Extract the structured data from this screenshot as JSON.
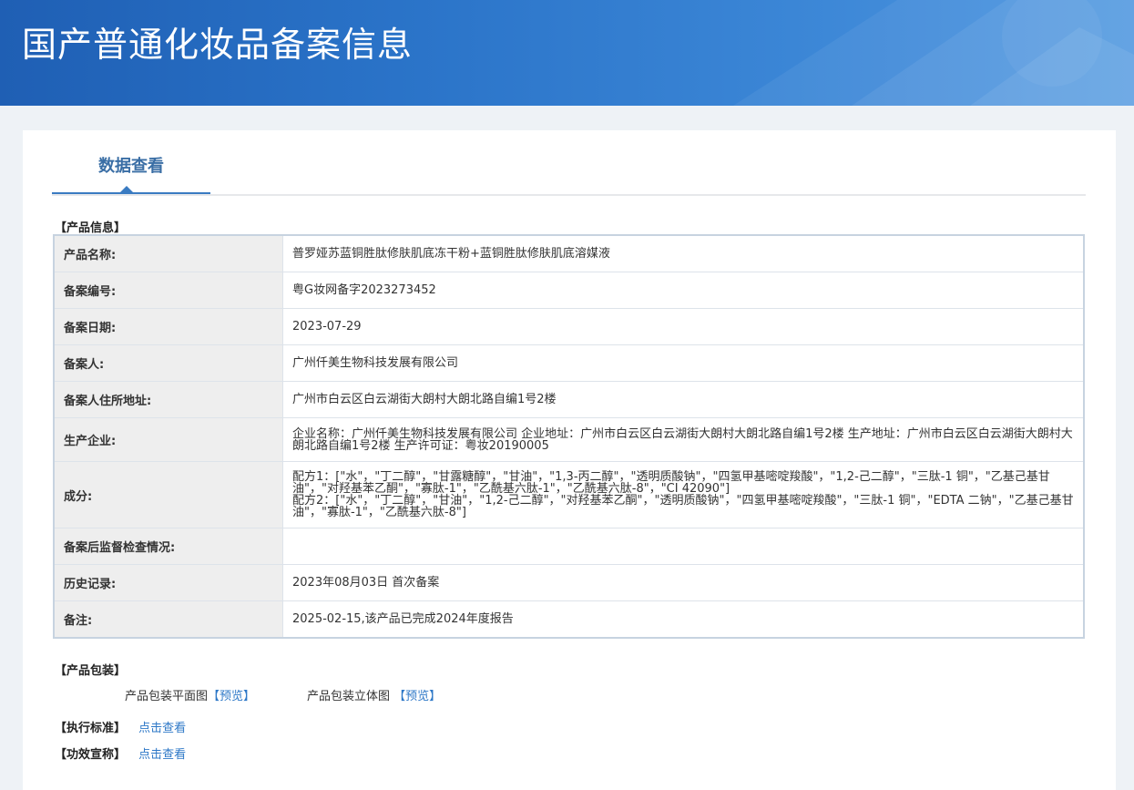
{
  "header": {
    "title": "国产普通化妆品备案信息"
  },
  "tabs": [
    {
      "label": "数据查看"
    }
  ],
  "product_info": {
    "section_title": "【产品信息】",
    "rows": [
      {
        "key": "产品名称:",
        "value": "普罗娅苏蓝铜胜肽修肤肌底冻干粉+蓝铜胜肽修肤肌底溶媒液"
      },
      {
        "key": "备案编号:",
        "value": "粤G妆网备字2023273452"
      },
      {
        "key": "备案日期:",
        "value": "2023-07-29"
      },
      {
        "key": "备案人:",
        "value": "广州仟美生物科技发展有限公司"
      },
      {
        "key": "备案人住所地址:",
        "value": "广州市白云区白云湖街大朗村大朗北路自编1号2楼"
      },
      {
        "key": "生产企业:",
        "value": "企业名称：广州仟美生物科技发展有限公司 企业地址：广州市白云区白云湖街大朗村大朗北路自编1号2楼 生产地址：广州市白云区白云湖街大朗村大朗北路自编1号2楼 生产许可证：粤妆20190005"
      },
      {
        "key": "成分:",
        "value_line1": "配方1：[\"水\"，\"丁二醇\"，\"甘露糖醇\"，\"甘油\"，\"1,3-丙二醇\"，\"透明质酸钠\"，\"四氢甲基嘧啶羧酸\"，\"1,2-己二醇\"，\"三肽-1 铜\"，\"乙基己基甘油\"，\"对羟基苯乙酮\"，\"寡肽-1\"，\"乙酰基六肽-1\"，\"乙酰基六肽-8\"，\"CI 42090\"]",
        "value_line2": "配方2：[\"水\"，\"丁二醇\"，\"甘油\"，\"1,2-己二醇\"，\"对羟基苯乙酮\"，\"透明质酸钠\"，\"四氢甲基嘧啶羧酸\"，\"三肽-1 铜\"，\"EDTA 二钠\"，\"乙基己基甘油\"，\"寡肽-1\"，\"乙酰基六肽-8\"]"
      },
      {
        "key": "备案后监督检查情况:",
        "value": ""
      },
      {
        "key": "历史记录:",
        "value": "2023年08月03日 首次备案"
      },
      {
        "key": "备注:",
        "value": "2025-02-15,该产品已完成2024年度报告"
      }
    ]
  },
  "packaging": {
    "section_title": "【产品包装】",
    "flat_label": "产品包装平面图",
    "flat_preview": "【预览】",
    "solid_label": "产品包装立体图",
    "solid_preview": "【预览】"
  },
  "standard": {
    "label": "【执行标准】",
    "link": "点击查看"
  },
  "efficacy": {
    "label": "【功效宣称】",
    "link": "点击查看"
  }
}
